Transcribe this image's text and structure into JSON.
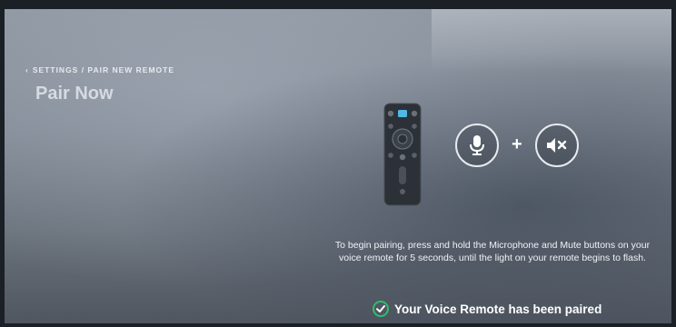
{
  "breadcrumb": {
    "back_icon": "chevron-left-icon",
    "text": "SETTINGS / PAIR NEW REMOTE"
  },
  "page": {
    "title": "Pair Now"
  },
  "pairing": {
    "remote_icon": "voice-remote-icon",
    "microphone_icon": "microphone-icon",
    "plus_text": "+",
    "mute_icon": "mute-icon",
    "instructions": "To begin pairing, press and hold the Microphone and Mute buttons on your voice remote for 5 seconds, until the light on your remote begins to flash.",
    "status_icon": "check-circle-icon",
    "status_text": "Your Voice Remote has been paired"
  },
  "colors": {
    "success": "#2bbf6a",
    "text": "#ffffff",
    "accent_light": "#4fb8e6"
  }
}
